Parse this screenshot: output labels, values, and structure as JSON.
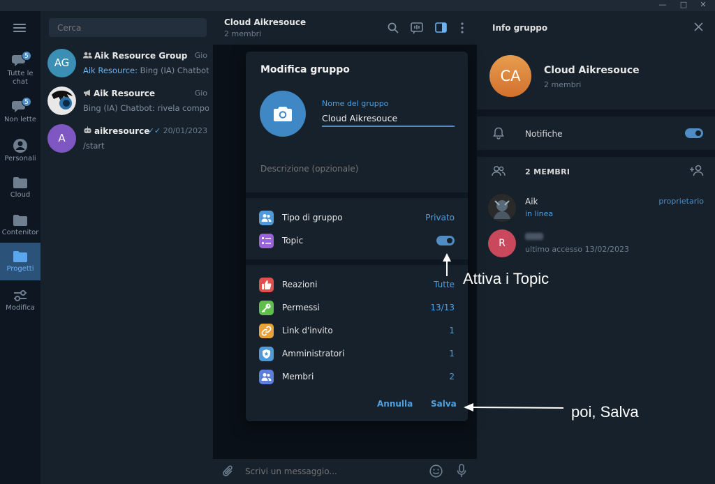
{
  "chat_list": {
    "search_placeholder": "Cerca",
    "chats": [
      {
        "avatar_text": "AG",
        "avatar_color": "#3b8eb4",
        "type_icon": "group-icon",
        "name": "Aik Resource Group",
        "time": "Gio",
        "preview_sender": "Aik Resource:",
        "preview_text": "Bing (IA) Chatbot: ..."
      },
      {
        "avatar_text": "",
        "avatar_color": "#1d1d1d",
        "type_icon": "megaphone-icon",
        "name": "Aik Resource",
        "time": "Gio",
        "preview_sender": "",
        "preview_text": "Bing (IA) Chatbot: rivela compor..."
      },
      {
        "avatar_text": "A",
        "avatar_color": "#7f57c2",
        "type_icon": "bot-icon",
        "name": "aikresource",
        "time": "20/01/2023",
        "preview_sender": "",
        "preview_text": "/start"
      }
    ]
  },
  "rail": {
    "items": [
      {
        "label": "Tutte le chat",
        "badge": "5",
        "icon": "chats-icon"
      },
      {
        "label": "Non lette",
        "badge": "5",
        "icon": "unread-icon"
      },
      {
        "label": "Personali",
        "badge": "",
        "icon": "person-icon"
      },
      {
        "label": "Cloud",
        "badge": "",
        "icon": "folder-icon"
      },
      {
        "label": "Contenitor",
        "badge": "",
        "icon": "folder-icon"
      },
      {
        "label": "Progetti",
        "badge": "",
        "icon": "folder-icon",
        "active": true
      },
      {
        "label": "Modifica",
        "badge": "",
        "icon": "sliders-icon"
      }
    ]
  },
  "chat_header": {
    "title": "Cloud Aikresouce",
    "subtitle": "2 membri"
  },
  "composer": {
    "placeholder": "Scrivi un messaggio..."
  },
  "info_panel": {
    "title": "Info gruppo",
    "avatar_text": "CA",
    "group_name": "Cloud Aikresouce",
    "group_sub": "2 membri",
    "notifications_label": "Notifiche",
    "members_header": "2 MEMBRI",
    "members": [
      {
        "avatar_text": "",
        "avatar_color": "#222222",
        "name": "Aik",
        "status": "in linea",
        "role": "proprietario",
        "online": true
      },
      {
        "avatar_text": "R",
        "avatar_color": "#c9485b",
        "name": "",
        "status": "ultimo accesso 13/02/2023",
        "role": "",
        "online": false
      }
    ]
  },
  "modal": {
    "title": "Modifica gruppo",
    "name_label": "Nome del gruppo",
    "name_value": "Cloud Aikresouce",
    "description_placeholder": "Descrizione (opzionale)",
    "rows_a": [
      {
        "label": "Tipo di gruppo",
        "value": "Privato",
        "icon": "group-type-icon",
        "color": "#4f9bd9"
      },
      {
        "label": "Topic",
        "value": "",
        "icon": "topics-icon",
        "color": "#9b63d9",
        "toggle_on": true
      }
    ],
    "rows_b": [
      {
        "label": "Reazioni",
        "value": "Tutte",
        "icon": "thumbs-up-icon",
        "color": "#e0504f"
      },
      {
        "label": "Permessi",
        "value": "13/13",
        "icon": "key-icon",
        "color": "#5fbf4a"
      },
      {
        "label": "Link d'invito",
        "value": "1",
        "icon": "link-icon",
        "color": "#e8a23a"
      },
      {
        "label": "Amministratori",
        "value": "1",
        "icon": "shield-icon",
        "color": "#4f9bd9"
      },
      {
        "label": "Membri",
        "value": "2",
        "icon": "members-icon",
        "color": "#5b7fdb"
      }
    ],
    "cancel_label": "Annulla",
    "save_label": "Salva"
  },
  "annotations": {
    "topic_hint": "Attiva i Topic",
    "save_hint": "poi, Salva"
  }
}
